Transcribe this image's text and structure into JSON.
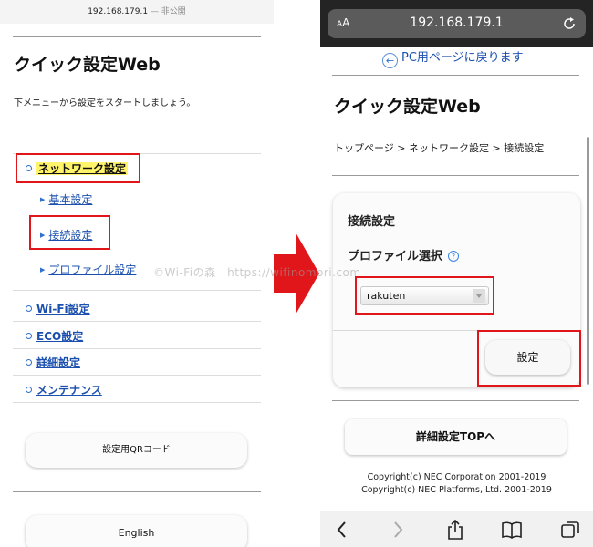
{
  "left": {
    "url_host": "192.168.179.1",
    "url_suffix": "— 非公開",
    "title": "クイック設定Web",
    "lead": "下メニューから設定をスタートしましょう。",
    "menu": {
      "network": "ネットワーク設定",
      "sub_basic": "基本設定",
      "sub_connection": "接続設定",
      "sub_profile": "プロファイル設定",
      "wifi": "Wi-Fi設定",
      "eco": "ECO設定",
      "advanced": "詳細設定",
      "maintenance": "メンテナンス"
    },
    "qr_button": "設定用QRコード",
    "english_button": "English"
  },
  "watermark": "©Wi-Fiの森　https://wifinomori.com",
  "right": {
    "aa_label_small": "A",
    "aa_label_big": "A",
    "url_host": "192.168.179.1",
    "back_link": "PC用ページに戻ります",
    "title": "クイック設定Web",
    "breadcrumb": "トップページ > ネットワーク設定 > 接続設定",
    "card_title": "接続設定",
    "profile_label": "プロファイル選択",
    "help_mark": "?",
    "profile_selected": "rakuten",
    "set_button": "設定",
    "advanced_top_button": "詳細設定TOPへ",
    "copyright1": "Copyright(c) NEC Corporation 2001-2019",
    "copyright2": "Copyright(c) NEC Platforms, Ltd. 2001-2019"
  },
  "colors": {
    "highlight_box": "#e0161a",
    "arrow": "#e0161a",
    "link": "#1b4fae",
    "highlight_bg": "#fff36a"
  }
}
